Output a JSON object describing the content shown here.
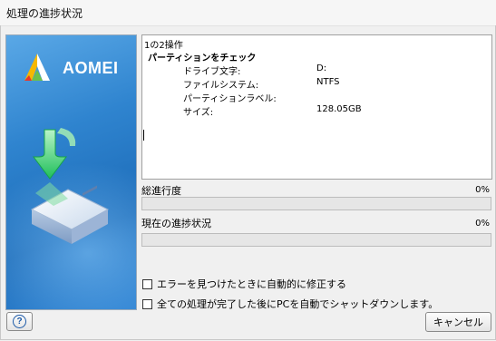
{
  "window": {
    "title": "処理の進捗状況"
  },
  "brand": {
    "name": "AOMEI"
  },
  "log": {
    "header": "1の2操作",
    "operation": "パーティションをチェック",
    "details": [
      {
        "label": "ドライブ文字:",
        "value": "D:"
      },
      {
        "label": "ファイルシステム:",
        "value": "NTFS"
      },
      {
        "label": "パーティションラベル:",
        "value": ""
      },
      {
        "label": "サイズ:",
        "value": "128.05GB"
      }
    ]
  },
  "progress": {
    "overall": {
      "label": "総進行度",
      "percent_text": "0%",
      "value": 0
    },
    "current": {
      "label": "現在の進捗状況",
      "percent_text": "0%",
      "value": 0
    }
  },
  "options": {
    "auto_fix": {
      "label": "エラーを見つけたときに自動的に修正する",
      "checked": false
    },
    "auto_shutdown": {
      "label": "全ての処理が完了した後にPCを自動でシャットダウンします。",
      "checked": false
    }
  },
  "buttons": {
    "cancel": "キャンセル",
    "help_icon": "question-icon"
  },
  "colors": {
    "panel_blue": "#2f84cf",
    "progress_green": "#06b025",
    "arrow_green": "#2ecc71"
  }
}
